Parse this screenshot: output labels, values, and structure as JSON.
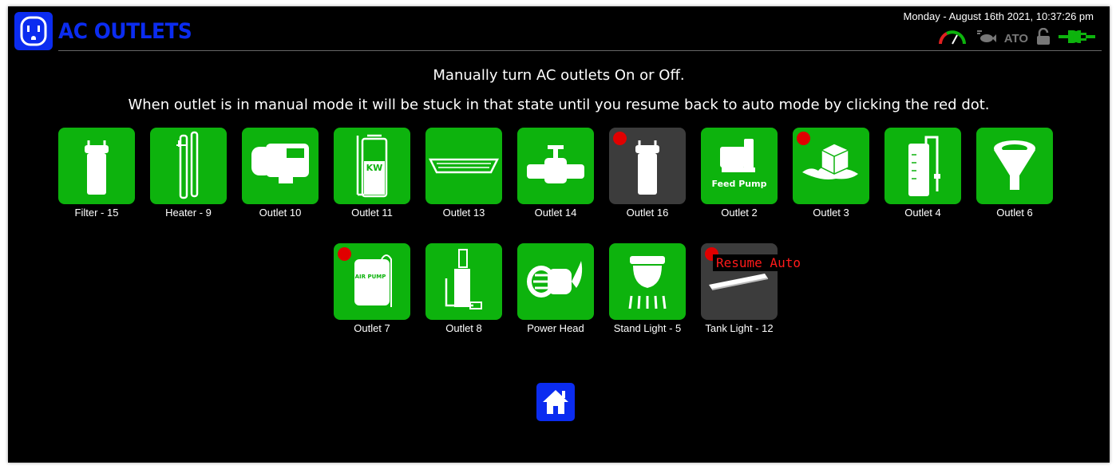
{
  "header": {
    "title": "AC OUTLETS",
    "datetime": "Monday - August 16th 2021, 10:37:26 pm",
    "status_icons": [
      "gauge-icon",
      "fish-icon",
      "ato-indicator",
      "unlock-icon",
      "power-plug-icon"
    ],
    "ato_label": "ATO"
  },
  "instructions": {
    "line1": "Manually turn AC outlets On or Off.",
    "line2": "When outlet is in manual mode it will be stuck in that state until you resume back to auto mode by clicking the red dot."
  },
  "outlets": [
    {
      "label": "Filter - 15",
      "icon": "canister-filter-icon",
      "state": "on",
      "manual": false
    },
    {
      "label": "Heater - 9",
      "icon": "heater-icon",
      "state": "on",
      "manual": false
    },
    {
      "label": "Outlet 10",
      "icon": "auto-feeder-icon",
      "state": "on",
      "manual": false
    },
    {
      "label": "Outlet 11",
      "icon": "kalkwasser-reactor-icon",
      "icon_text": "KW",
      "state": "on",
      "manual": false
    },
    {
      "label": "Outlet 13",
      "icon": "led-light-icon",
      "state": "on",
      "manual": false
    },
    {
      "label": "Outlet 14",
      "icon": "valve-icon",
      "state": "on",
      "manual": false
    },
    {
      "label": "Outlet 16",
      "icon": "canister-filter-icon",
      "state": "off",
      "manual": true
    },
    {
      "label": "Outlet 2",
      "icon": "feed-pump-icon",
      "icon_text": "Feed Pump",
      "state": "on",
      "manual": false
    },
    {
      "label": "Outlet 3",
      "icon": "ice-cube-icon",
      "state": "on",
      "manual": true
    },
    {
      "label": "Outlet 4",
      "icon": "hob-filter-icon",
      "state": "on",
      "manual": false
    },
    {
      "label": "Outlet 6",
      "icon": "funnel-icon",
      "state": "on",
      "manual": false
    },
    {
      "label": "Outlet 7",
      "icon": "air-pump-icon",
      "icon_text": "AIR PUMP",
      "state": "on",
      "manual": true
    },
    {
      "label": "Outlet 8",
      "icon": "protein-skimmer-icon",
      "state": "on",
      "manual": false
    },
    {
      "label": "Power Head",
      "icon": "powerhead-icon",
      "state": "on",
      "manual": false
    },
    {
      "label": "Stand Light - 5",
      "icon": "stand-light-icon",
      "state": "on",
      "manual": false
    },
    {
      "label": "Tank Light - 12",
      "icon": "tank-light-icon",
      "state": "off",
      "manual": true
    }
  ],
  "tooltip": "Resume Auto",
  "footer": {
    "home_icon": "home-icon"
  },
  "colors": {
    "on": "#0db30d",
    "off": "#3c3c3c",
    "accent": "#0b2cf0",
    "manual_dot": "#e00000"
  }
}
